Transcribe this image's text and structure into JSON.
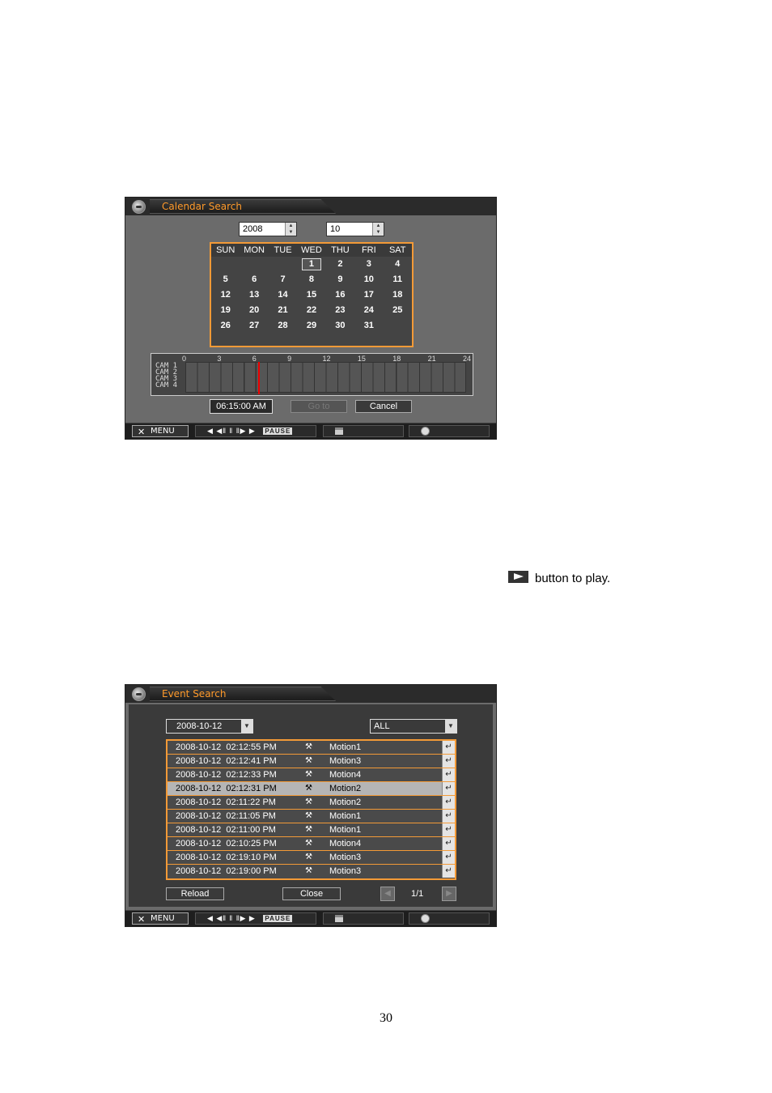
{
  "calendar_search": {
    "title": "Calendar Search",
    "year": "2008",
    "month": "10",
    "weekdays": [
      "SUN",
      "MON",
      "TUE",
      "WED",
      "THU",
      "FRI",
      "SAT"
    ],
    "weeks": [
      [
        "",
        "",
        "",
        "1",
        "2",
        "3",
        "4"
      ],
      [
        "5",
        "6",
        "7",
        "8",
        "9",
        "10",
        "11"
      ],
      [
        "12",
        "13",
        "14",
        "15",
        "16",
        "17",
        "18"
      ],
      [
        "19",
        "20",
        "21",
        "22",
        "23",
        "24",
        "25"
      ],
      [
        "26",
        "27",
        "28",
        "29",
        "30",
        "31",
        ""
      ]
    ],
    "selected_day": "1",
    "timeline_hours": [
      "0",
      "3",
      "6",
      "9",
      "12",
      "15",
      "18",
      "21",
      "24"
    ],
    "timeline_cameras": [
      "CAM 1",
      "CAM 2",
      "CAM 3",
      "CAM 4"
    ],
    "timeline_cursor_hour": 6.25,
    "time": "06:15:00 AM",
    "goto_label": "Go to",
    "cancel_label": "Cancel"
  },
  "bottom_bar": {
    "menu_label": "MENU",
    "playback_glyphs": "◀ ◀‖ ‖ ‖▶ ▶",
    "pause_label": "PAUSE"
  },
  "instruction": {
    "text": "button to play."
  },
  "event_search": {
    "title": "Event Search",
    "date_filter": "2008-10-12",
    "type_filter": "ALL",
    "events": [
      {
        "date": "2008-10-12",
        "time": "02:12:55 PM",
        "event": "Motion1",
        "selected": false
      },
      {
        "date": "2008-10-12",
        "time": "02:12:41 PM",
        "event": "Motion3",
        "selected": false
      },
      {
        "date": "2008-10-12",
        "time": "02:12:33 PM",
        "event": "Motion4",
        "selected": false
      },
      {
        "date": "2008-10-12",
        "time": "02:12:31 PM",
        "event": "Motion2",
        "selected": true
      },
      {
        "date": "2008-10-12",
        "time": "02:11:22 PM",
        "event": "Motion2",
        "selected": false
      },
      {
        "date": "2008-10-12",
        "time": "02:11:05 PM",
        "event": "Motion1",
        "selected": false
      },
      {
        "date": "2008-10-12",
        "time": "02:11:00 PM",
        "event": "Motion1",
        "selected": false
      },
      {
        "date": "2008-10-12",
        "time": "02:10:25 PM",
        "event": "Motion4",
        "selected": false
      },
      {
        "date": "2008-10-12",
        "time": "02:19:10 PM",
        "event": "Motion3",
        "selected": false
      },
      {
        "date": "2008-10-12",
        "time": "02:19:00 PM",
        "event": "Motion3",
        "selected": false
      }
    ],
    "reload_label": "Reload",
    "close_label": "Close",
    "page": "1/1"
  },
  "page_number": "30",
  "colors": {
    "accent_orange": "#f39a37",
    "title_orange": "#ff9a2a",
    "cursor_red": "#ee0000"
  }
}
